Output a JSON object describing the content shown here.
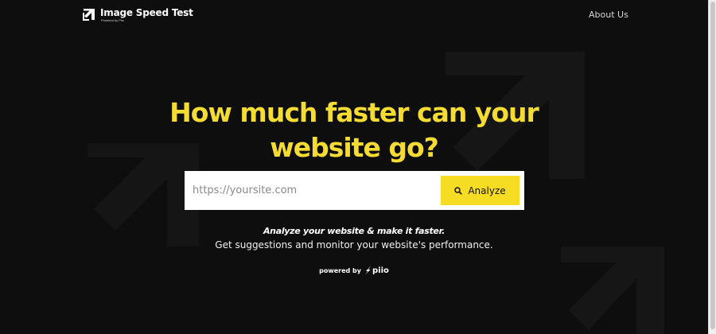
{
  "header": {
    "logo_title": "Image Speed Test",
    "logo_subtitle": "Powered by Piio",
    "logo_icon": "arrow-up-right-square-icon",
    "nav_about": "About Us"
  },
  "hero": {
    "headline_line1": "How much faster can your",
    "headline_line2": "website go?",
    "search_placeholder": "https://yoursite.com",
    "analyze_label": "Analyze",
    "analyze_icon": "search-icon",
    "tagline": "Analyze your website & make it faster.",
    "subline": "Get suggestions and monitor your website's performance.",
    "powered_by": "powered by",
    "powered_brand": "piio"
  },
  "colors": {
    "background": "#0e0e0e",
    "accent": "#f6dc22",
    "headline": "#f4dc32"
  }
}
